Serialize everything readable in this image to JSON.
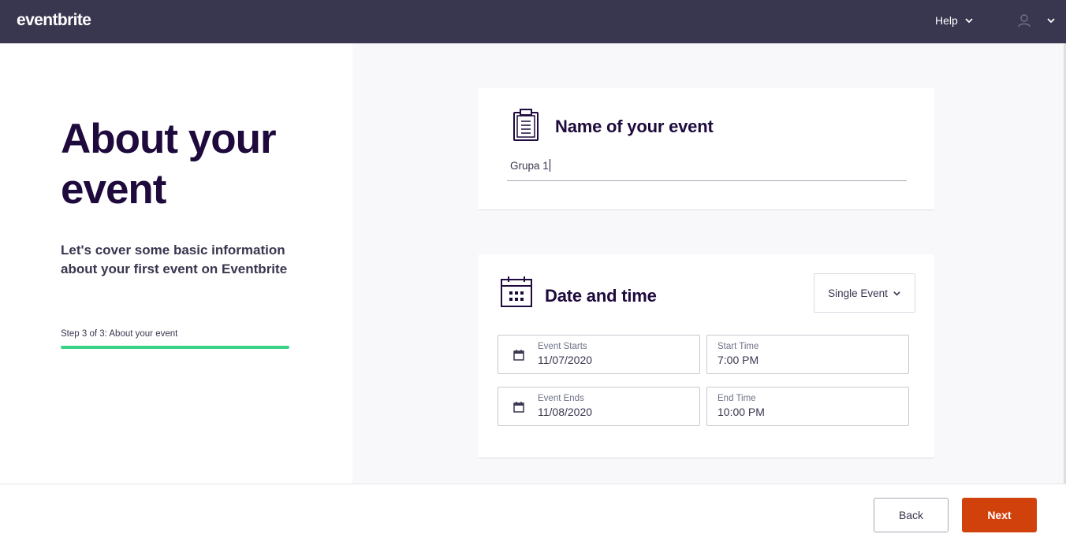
{
  "topbar": {
    "logo": "eventbrite",
    "help_label": "Help"
  },
  "left": {
    "title": "About your event",
    "subtitle": "Let's cover some basic information about your first event on Eventbrite",
    "step_text": "Step 3 of 3: About your event",
    "progress_fraction": 1.0
  },
  "name_card": {
    "title": "Name of your event",
    "value": "Grupa 1"
  },
  "date_card": {
    "title": "Date and time",
    "event_type": "Single Event",
    "event_starts_label": "Event Starts",
    "event_starts_value": "11/07/2020",
    "start_time_label": "Start Time",
    "start_time_value": "7:00 PM",
    "event_ends_label": "Event Ends",
    "event_ends_value": "11/08/2020",
    "end_time_label": "End Time",
    "end_time_value": "10:00 PM"
  },
  "footer": {
    "back_label": "Back",
    "next_label": "Next"
  },
  "colors": {
    "topbar": "#39364f",
    "title": "#1e0a3c",
    "progress": "#3bd186",
    "next_button": "#d1410c",
    "background_right": "#f8f7fa"
  },
  "icons": {
    "help_chevron": "chevron-down-icon",
    "user": "user-icon",
    "name_card": "clipboard-icon",
    "date_card": "calendar-icon",
    "date_field": "calendar-small-icon"
  }
}
